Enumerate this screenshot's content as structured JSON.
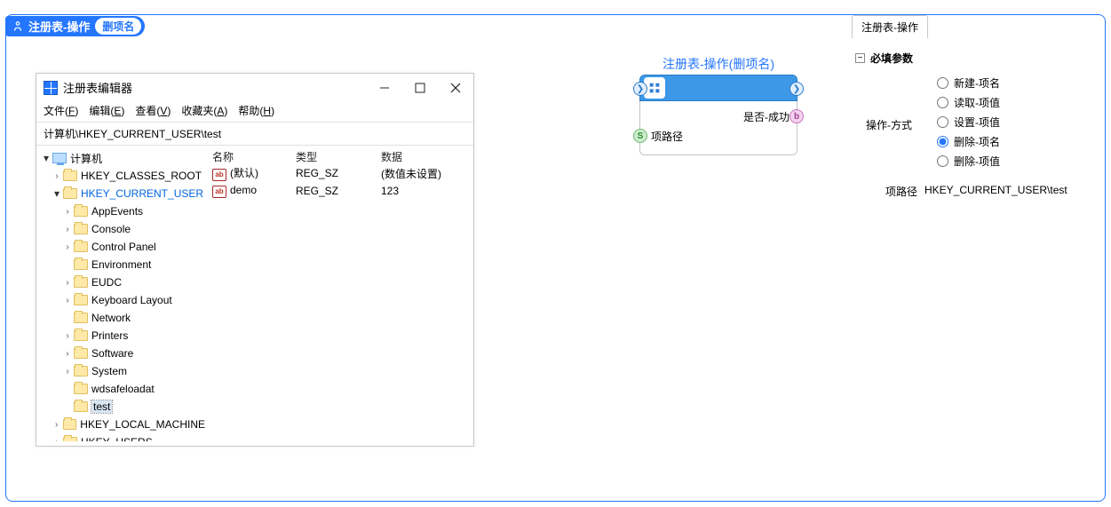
{
  "header": {
    "title": "注册表-操作",
    "pill": "删项名"
  },
  "regedit": {
    "title": "注册表编辑器",
    "menus": [
      "文件(F)",
      "编辑(E)",
      "查看(V)",
      "收藏夹(A)",
      "帮助(H)"
    ],
    "path": "计算机\\HKEY_CURRENT_USER\\test",
    "root": "计算机",
    "hives": [
      "HKEY_CLASSES_ROOT",
      "HKEY_CURRENT_USER",
      "HKEY_LOCAL_MACHINE",
      "HKEY_USERS"
    ],
    "subkeys": [
      "AppEvents",
      "Console",
      "Control Panel",
      "Environment",
      "EUDC",
      "Keyboard Layout",
      "Network",
      "Printers",
      "Software",
      "System",
      "wdsafeloadat",
      "test"
    ],
    "cols": {
      "name": "名称",
      "type": "类型",
      "data": "数据"
    },
    "rows": [
      {
        "name": "(默认)",
        "type": "REG_SZ",
        "data": "(数值未设置)"
      },
      {
        "name": "demo",
        "type": "REG_SZ",
        "data": "123"
      }
    ]
  },
  "node": {
    "title": "注册表-操作(删项名)",
    "out1": "是否-成功",
    "in1": "项路径",
    "S": "S",
    "b": "b"
  },
  "panel": {
    "tab": "注册表-操作",
    "section": "必填参数",
    "opLabel": "操作-方式",
    "options": [
      "新建-项名",
      "读取-项值",
      "设置-项值",
      "删除-项名",
      "删除-项值"
    ],
    "selected": 3,
    "pathLabel": "项路径",
    "pathValue": "HKEY_CURRENT_USER\\test"
  }
}
